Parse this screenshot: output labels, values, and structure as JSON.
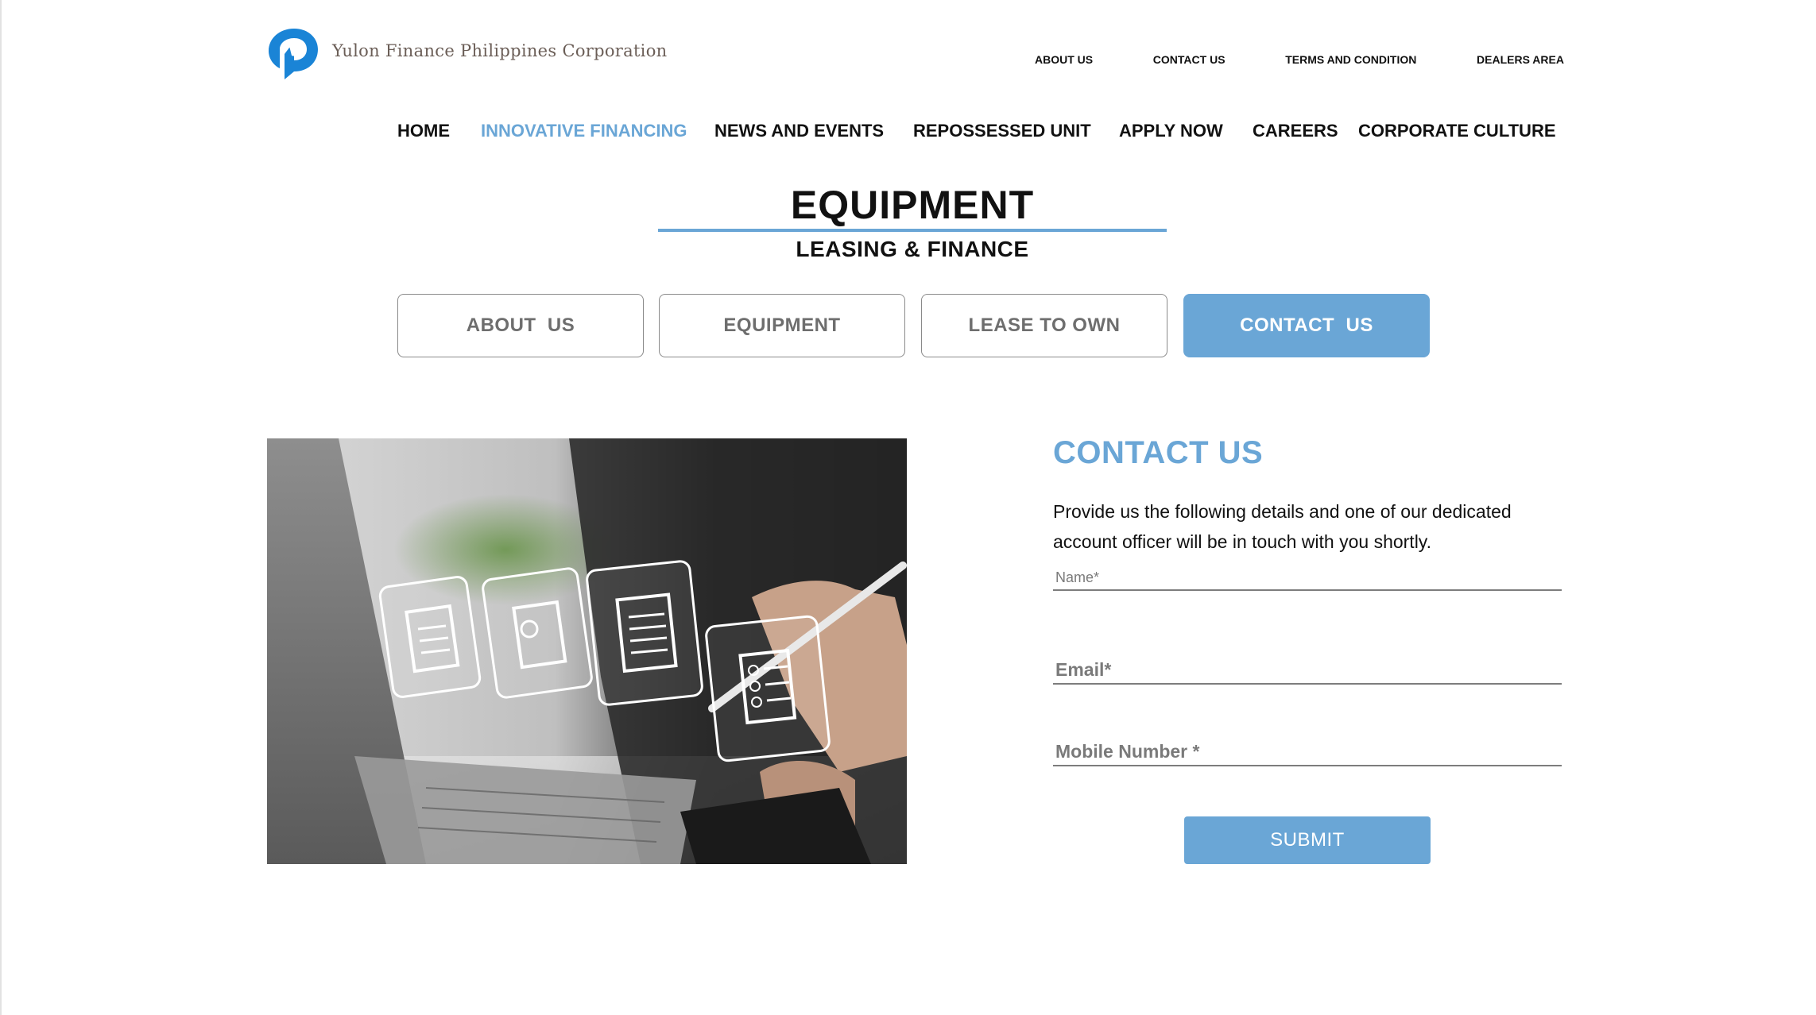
{
  "brand": {
    "name": "Yulon Finance Philippines Corporation",
    "logo_icon": "yulon-logo-icon",
    "accent_color": "#6aa6d6",
    "logo_blue": "#1a84d6"
  },
  "utility_nav": {
    "items": [
      {
        "label": "ABOUT US"
      },
      {
        "label": "CONTACT US"
      },
      {
        "label": "TERMS AND CONDITION"
      },
      {
        "label": "DEALERS AREA"
      }
    ]
  },
  "main_nav": {
    "items": [
      {
        "label": "HOME",
        "active": false
      },
      {
        "label": "INNOVATIVE FINANCING",
        "active": true
      },
      {
        "label": "NEWS AND EVENTS",
        "active": false
      },
      {
        "label": "REPOSSESSED UNIT",
        "active": false
      },
      {
        "label": "APPLY NOW",
        "active": false
      },
      {
        "label": "CAREERS",
        "active": false
      },
      {
        "label": "CORPORATE CULTURE",
        "active": false
      }
    ]
  },
  "hero": {
    "title": "EQUIPMENT",
    "subtitle": "LEASING & FINANCE"
  },
  "subtabs": {
    "items": [
      {
        "label": "ABOUT  US",
        "active": false
      },
      {
        "label": "EQUIPMENT",
        "active": false
      },
      {
        "label": "LEASE TO OWN",
        "active": false
      },
      {
        "label": "CONTACT  US",
        "active": true
      }
    ]
  },
  "image": {
    "icon": "laptop-documents-photo"
  },
  "contact": {
    "heading": "CONTACT US",
    "description": "Provide us the following details and one of our dedicated account officer will be in touch with you shortly.",
    "fields": {
      "name_placeholder": "Name*",
      "name_value": "",
      "email_placeholder": "Email*",
      "email_value": "",
      "mobile_placeholder": "Mobile Number *",
      "mobile_value": ""
    },
    "submit_label": "SUBMIT"
  }
}
